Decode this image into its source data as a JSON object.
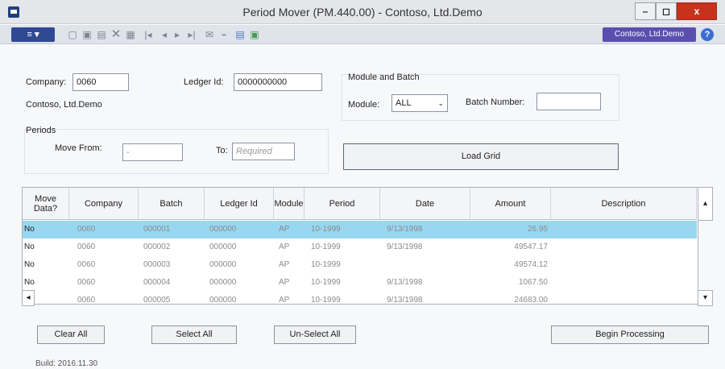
{
  "window": {
    "title": "Period Mover (PM.440.00) - Contoso, Ltd.Demo",
    "minimize": "–",
    "maximize": "◻",
    "close": "x"
  },
  "toolbar": {
    "action_label": "≡",
    "company_badge": "Contoso, Ltd.Demo",
    "help": "?",
    "icons": [
      "new-icon",
      "save-icon",
      "copy-icon",
      "delete-icon",
      "grid-icon",
      "first-record-icon",
      "previous-record-icon",
      "next-record-icon",
      "last-record-icon",
      "send-icon",
      "attach-icon",
      "print-icon",
      "refresh-icon"
    ]
  },
  "form": {
    "company_label": "Company:",
    "company_value": "0060",
    "company_name": "Contoso, Ltd.Demo",
    "ledger_label": "Ledger Id:",
    "ledger_value": "0000000000",
    "module_batch_title": "Module and Batch",
    "module_label": "Module:",
    "module_value": "ALL",
    "batch_number_label": "Batch Number:",
    "batch_number_value": "",
    "periods_title": "Periods",
    "move_from_label": "Move From:",
    "move_from_value": "-",
    "to_label": "To:",
    "to_placeholder": "Required",
    "load_grid": "Load Grid"
  },
  "grid": {
    "columns": [
      "Move Data?",
      "Company",
      "Batch",
      "Ledger Id",
      "Module",
      "Period",
      "Date",
      "Amount",
      "Description"
    ],
    "rows": [
      {
        "move": "No",
        "company": "0060",
        "batch": "000001",
        "ledger": "000000",
        "module": "AP",
        "period": "10-1999",
        "date": "9/13/1998",
        "amount": "26.95",
        "description": ""
      },
      {
        "move": "No",
        "company": "0060",
        "batch": "000002",
        "ledger": "000000",
        "module": "AP",
        "period": "10-1999",
        "date": "9/13/1998",
        "amount": "49547.17",
        "description": ""
      },
      {
        "move": "No",
        "company": "0060",
        "batch": "000003",
        "ledger": "000000",
        "module": "AP",
        "period": "10-1999",
        "date": "",
        "amount": "49574.12",
        "description": ""
      },
      {
        "move": "No",
        "company": "0060",
        "batch": "000004",
        "ledger": "000000",
        "module": "AP",
        "period": "10-1999",
        "date": "9/13/1998",
        "amount": "1067.50",
        "description": ""
      },
      {
        "move": "No",
        "company": "0060",
        "batch": "000005",
        "ledger": "000000",
        "module": "AP",
        "period": "10-1999",
        "date": "9/13/1998",
        "amount": "24683.00",
        "description": ""
      }
    ],
    "selected_row": 0
  },
  "buttons": {
    "clear_all": "Clear All",
    "select_all": "Select All",
    "unselect_all": "Un-Select All",
    "begin_processing": "Begin Processing"
  },
  "footer": {
    "build": "Build: 2016.11.30"
  },
  "colors": {
    "selected_row": "#99d7f1",
    "close_button": "#c6331d",
    "company_badge": "#5b4fae",
    "action_menu": "#2f4a93"
  }
}
